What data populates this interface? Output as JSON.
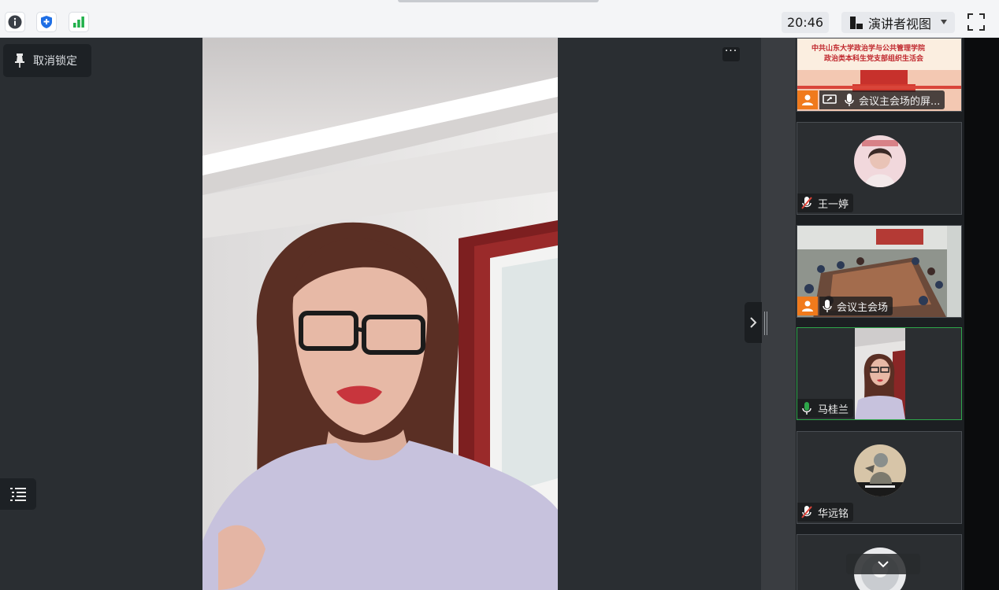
{
  "toolbar": {
    "info_icon": "info-icon",
    "security_icon": "shield-icon",
    "signal_icon": "signal-icon",
    "time": "20:46",
    "view_mode_label": "演讲者视图",
    "fullscreen_icon": "fullscreen-icon"
  },
  "stage": {
    "unlock_label": "取消锁定",
    "more_label": "···"
  },
  "participants": [
    {
      "name": "会议主会场的屏...",
      "host": true,
      "muted": false,
      "sharing": true,
      "banner_line1": "中共山东大学政治学与公共管理学院",
      "banner_line2": "政治类本科生党支部组织生活会"
    },
    {
      "name": "王一婷",
      "host": false,
      "muted": true
    },
    {
      "name": "会议主会场",
      "host": true,
      "muted": false
    },
    {
      "name": "马桂兰",
      "host": false,
      "muted": false,
      "speaking": true
    },
    {
      "name": "华远铭",
      "host": false,
      "muted": true
    },
    {
      "name": "",
      "host": false,
      "muted": false
    }
  ],
  "colors": {
    "accent_green": "#2ea64a",
    "host_orange": "#f07a1c",
    "muted_red": "#e0453a"
  }
}
